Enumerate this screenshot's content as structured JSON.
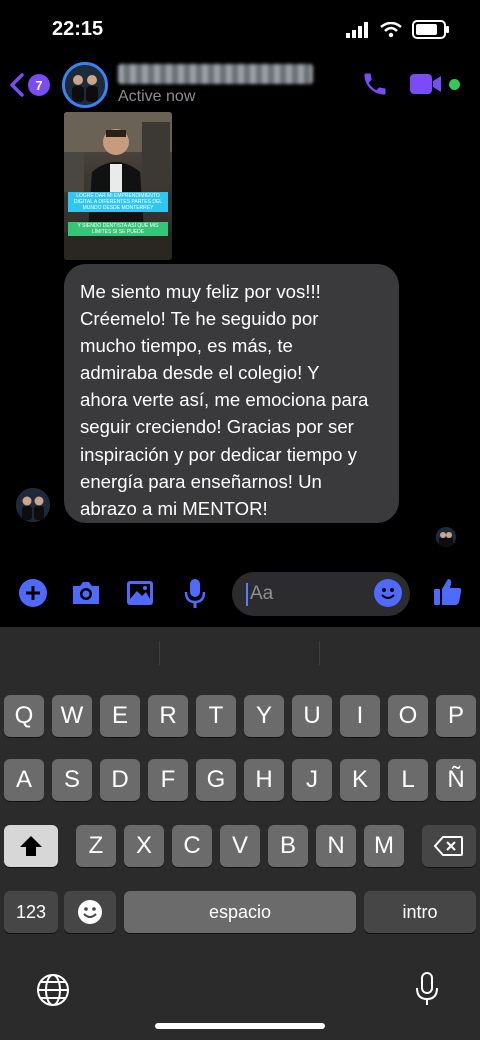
{
  "status_bar": {
    "time": "22:15"
  },
  "header": {
    "back_badge": "7",
    "status": "Active now"
  },
  "story": {
    "caption1": "LOGRÉ DAR MI EMPRENDIMIENTO DIGITAL A DIFERENTES PARTES DEL MUNDO DESDE MONTERREY",
    "caption2": "Y SIENDO DENTISTA ASÍ QUE MIS LÍMITES SI SE PUEDE"
  },
  "message": {
    "lines": [
      "Me siento muy feliz por vos!!!",
      "Créemelo! Te he seguido por",
      "mucho tiempo, es más, te",
      "admiraba desde el colegio! Y",
      "ahora verte así, me emociona para",
      "seguir creciendo! Gracias por ser",
      "inspiración y por dedicar tiempo y",
      "energía para enseñarnos! Un",
      "abrazo a mi MENTOR!"
    ]
  },
  "composer": {
    "placeholder": "Aa"
  },
  "keyboard": {
    "row1": [
      "Q",
      "W",
      "E",
      "R",
      "T",
      "Y",
      "U",
      "I",
      "O",
      "P"
    ],
    "row2": [
      "A",
      "S",
      "D",
      "F",
      "G",
      "H",
      "J",
      "K",
      "L",
      "Ñ"
    ],
    "row3": [
      "Z",
      "X",
      "C",
      "V",
      "B",
      "N",
      "M"
    ],
    "numbers_key": "123",
    "space_key": "espacio",
    "return_key": "intro"
  },
  "colors": {
    "accent": "#7b4cf6",
    "blue_icons": "#4f6bff",
    "bubble": "#3a3a3c",
    "online": "#34c759"
  }
}
